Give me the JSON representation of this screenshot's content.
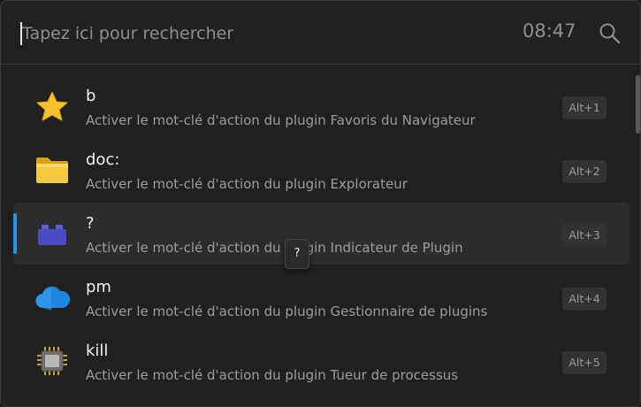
{
  "search": {
    "placeholder": "Tapez ici pour rechercher",
    "value": "",
    "clock": "08:47"
  },
  "results": [
    {
      "title": "b",
      "subtitle": "Activer le mot-clé d'action du plugin Favoris du Navigateur",
      "hotkey": "Alt+1",
      "icon": "star-icon"
    },
    {
      "title": "doc:",
      "subtitle": "Activer le mot-clé d'action du plugin Explorateur",
      "hotkey": "Alt+2",
      "icon": "folder-icon"
    },
    {
      "title": "?",
      "subtitle": "Activer le mot-clé d'action du plugin Indicateur de Plugin",
      "hotkey": "Alt+3",
      "icon": "lego-brick-icon"
    },
    {
      "title": "pm",
      "subtitle": "Activer le mot-clé d'action du plugin Gestionnaire de plugins",
      "hotkey": "Alt+4",
      "icon": "cloud-icon"
    },
    {
      "title": "kill",
      "subtitle": "Activer le mot-clé d'action du plugin Tueur de processus",
      "hotkey": "Alt+5",
      "icon": "cpu-chip-icon"
    }
  ],
  "tooltip": {
    "text": "?"
  },
  "colors": {
    "accent": "#2a93e8",
    "background": "#202020",
    "selected_row": "#2c2c2c"
  }
}
